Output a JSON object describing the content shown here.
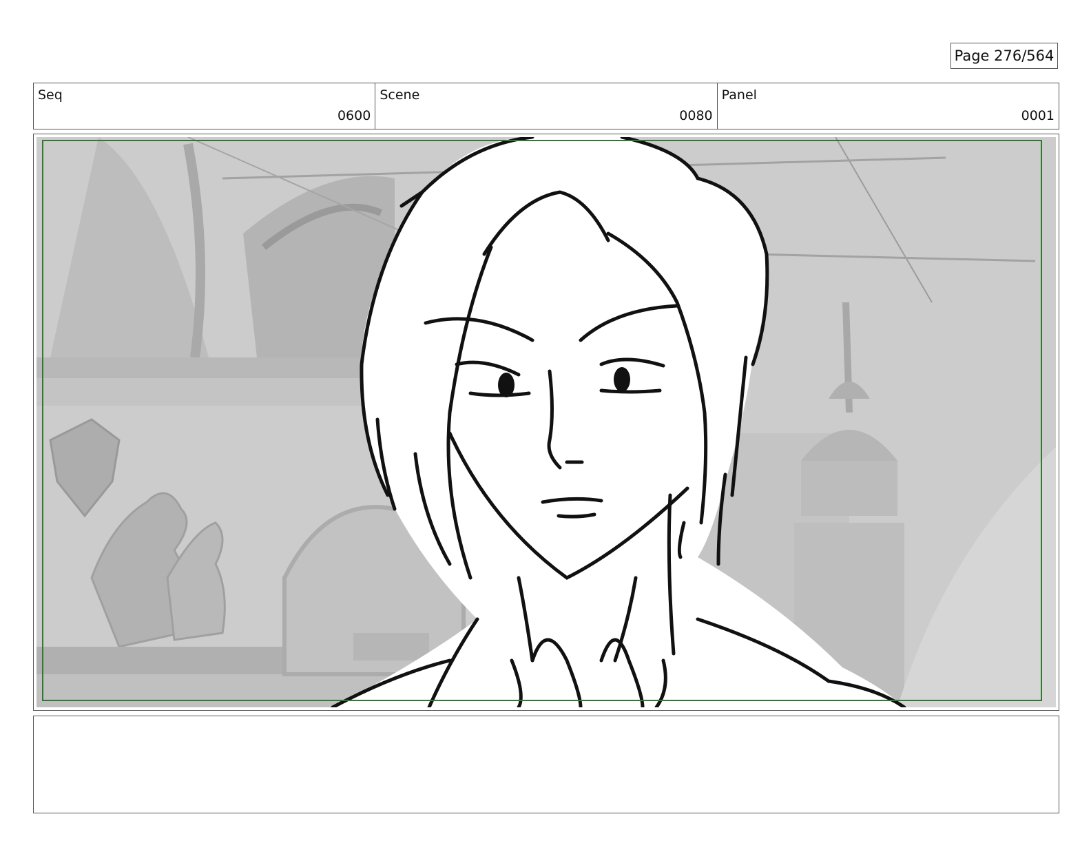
{
  "page": {
    "label": "Page 276/564"
  },
  "header": {
    "seq": {
      "label": "Seq",
      "value": "0600"
    },
    "scene": {
      "label": "Scene",
      "value": "0080"
    },
    "panel": {
      "label": "Panel",
      "value": "0001"
    }
  },
  "notes": {
    "text": ""
  },
  "colors": {
    "safe_frame": "#2f7a2f",
    "background_art": "#c8c8c8"
  },
  "icons": {
    "panel_image": "storyboard-drawing"
  }
}
